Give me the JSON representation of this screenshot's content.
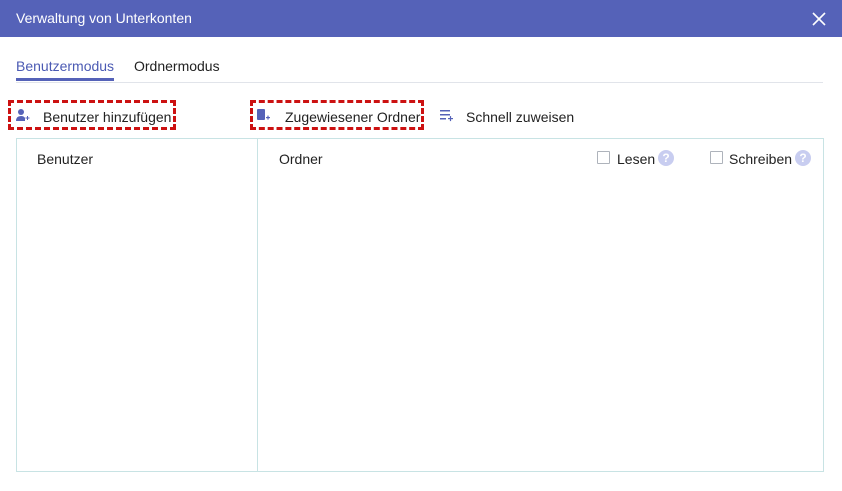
{
  "dialog": {
    "title": "Verwaltung von Unterkonten",
    "close_icon": "close-icon"
  },
  "tabs": [
    {
      "label": "Benutzermodus",
      "active": true
    },
    {
      "label": "Ordnermodus",
      "active": false
    }
  ],
  "toolbar": {
    "add_user_label": "Benutzer hinzufügen",
    "add_user_icon": "add-user-icon",
    "assigned_folder_label": "Zugewiesener Ordner",
    "assigned_folder_icon": "add-folder-icon",
    "quick_assign_label": "Schnell zuweisen",
    "quick_assign_icon": "list-add-icon"
  },
  "users_panel": {
    "header": "Benutzer"
  },
  "folders_panel": {
    "header": "Ordner",
    "read_label": "Lesen",
    "write_label": "Schreiben",
    "help_glyph": "?"
  },
  "colors": {
    "titlebar": "#5562b8",
    "accent": "#4b5ab3",
    "highlight_dashed": "#cc1111",
    "panel_border": "#c8e3e4"
  }
}
